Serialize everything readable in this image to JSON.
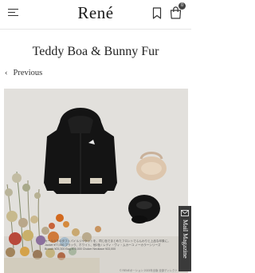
{
  "header": {
    "logo": "René",
    "cart_count": "0"
  },
  "page": {
    "title": "Teddy Boa & Bunny Fur",
    "back_label": "Previous"
  },
  "hero": {
    "caption_lines": [
      "カールつきのタフトパイルジャケットを、同じ色でまとめたフロントでふんわりと上品な印象に。",
      "Jacket ¥77,000 ブラック、ホワイト、他2色 / レディ・ヴィ・ムカーユ ノーカラーシリーズ",
      "Brooch ¥25,300 Bag ¥75,000 Choker Necklace ¥33,000"
    ],
    "copyright": "© RENEポーション 2023年出版 全部ディレクト"
  },
  "mail_tab": {
    "label": "Mail Magazine"
  },
  "colors": {
    "badge": "#444444",
    "mail_tab": "#3a3a3a",
    "hero_background": "#e2e0dc"
  }
}
